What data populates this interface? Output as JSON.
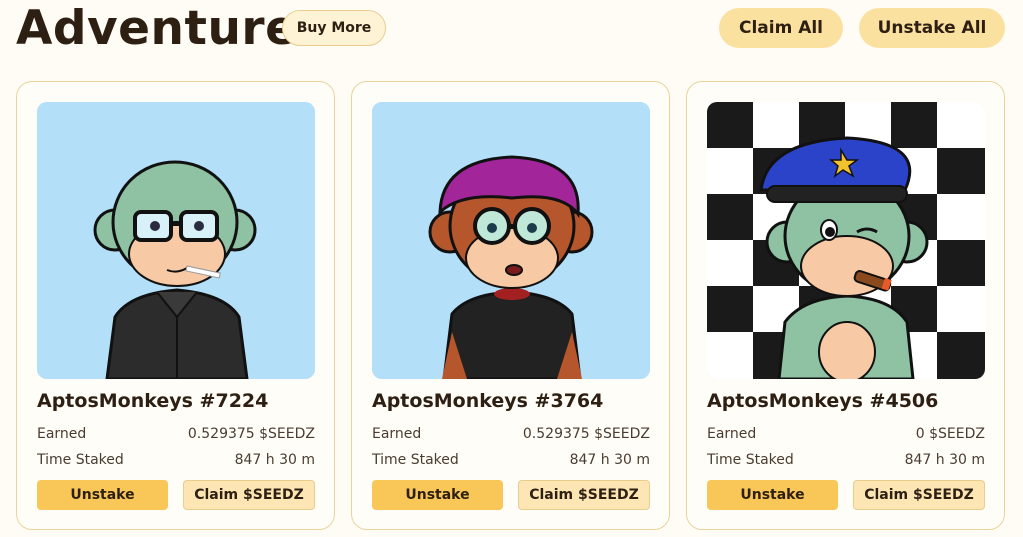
{
  "header": {
    "title": "Adventure",
    "buy_more_label": "Buy More",
    "claim_all_label": "Claim All",
    "unstake_all_label": "Unstake All"
  },
  "labels": {
    "earned": "Earned",
    "time_staked": "Time Staked",
    "unstake": "Unstake",
    "claim": "Claim $SEEDZ"
  },
  "cards": [
    {
      "name": "AptosMonkeys #7224",
      "earned": "0.529375 $SEEDZ",
      "time_staked": "847 h 30 m"
    },
    {
      "name": "AptosMonkeys #3764",
      "earned": "0.529375 $SEEDZ",
      "time_staked": "847 h 30 m"
    },
    {
      "name": "AptosMonkeys #4506",
      "earned": "0 $SEEDZ",
      "time_staked": "847 h 30 m"
    }
  ],
  "colors": {
    "background": "#fffcf5",
    "accent_yellow": "#f9c758",
    "soft_yellow": "#fde6b4",
    "text_dark": "#2e1f13"
  }
}
